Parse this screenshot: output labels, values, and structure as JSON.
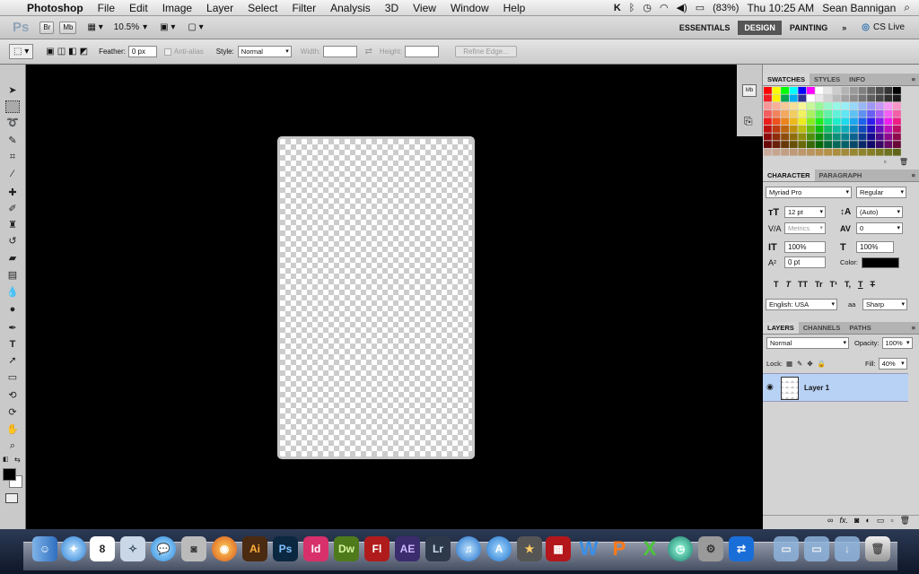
{
  "menubar": {
    "app": "Photoshop",
    "items": [
      "File",
      "Edit",
      "Image",
      "Layer",
      "Select",
      "Filter",
      "Analysis",
      "3D",
      "View",
      "Window",
      "Help"
    ],
    "battery": "(83%)",
    "clock": "Thu 10:25 AM",
    "user": "Sean Bannigan"
  },
  "appbar": {
    "logo": "Ps",
    "br": "Br",
    "mb": "Mb",
    "zoom": "10.5%",
    "workspaces": [
      "ESSENTIALS",
      "DESIGN",
      "PAINTING"
    ],
    "more": "»",
    "cslive": "CS Live"
  },
  "options": {
    "feather_label": "Feather:",
    "feather_value": "0 px",
    "antialias": "Anti-alias",
    "style_label": "Style:",
    "style_value": "Normal",
    "width_label": "Width:",
    "height_label": "Height:",
    "refine": "Refine Edge..."
  },
  "swatches": {
    "tabs": [
      "SWATCHES",
      "STYLES",
      "INFO"
    ]
  },
  "character": {
    "tabs": [
      "CHARACTER",
      "PARAGRAPH"
    ],
    "font": "Myriad Pro",
    "style": "Regular",
    "size": "12 pt",
    "leading": "(Auto)",
    "kerning": "Metrics",
    "tracking": "0",
    "vscale": "100%",
    "hscale": "100%",
    "baseline": "0 pt",
    "color_label": "Color:",
    "language": "English: USA",
    "aa_label": "aa",
    "aa": "Sharp",
    "type_buttons": [
      "T",
      "T",
      "TT",
      "Tr",
      "T¹",
      "T,",
      "T",
      "T"
    ]
  },
  "layers": {
    "tabs": [
      "LAYERS",
      "CHANNELS",
      "PATHS"
    ],
    "blend": "Normal",
    "opacity_label": "Opacity:",
    "opacity": "100%",
    "lock_label": "Lock:",
    "fill_label": "Fill:",
    "fill": "40%",
    "layer_name": "Layer 1"
  },
  "dock": [
    "Finder",
    "Safari",
    "iCal",
    "Preview",
    "iChat",
    "FaceTime",
    "Firefox",
    "Ai",
    "Ps",
    "Id",
    "Dw",
    "Fl",
    "AE",
    "Lr",
    "iTunes",
    "App Store",
    "iMovie",
    "Photo Booth",
    "W",
    "P",
    "X",
    "Time Machine",
    "System Preferences",
    "TeamViewer",
    "Applications",
    "Documents",
    "Downloads",
    "Trash"
  ],
  "dock_labels": {
    "ical_day": "8",
    "ai": "Ai",
    "ps": "Ps",
    "id": "Id",
    "dw": "Dw",
    "fl": "Fl",
    "ae": "AE",
    "lr": "Lr",
    "w": "W",
    "p": "P",
    "x": "X"
  }
}
